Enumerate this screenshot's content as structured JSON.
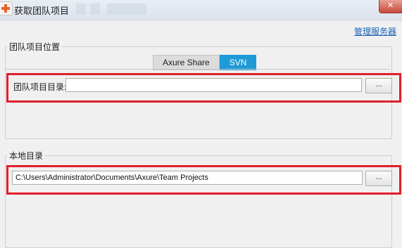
{
  "window": {
    "title": "获取团队项目"
  },
  "header": {
    "manage_link": "管理服务器"
  },
  "team_section": {
    "title": "团队项目位置",
    "tabs": [
      {
        "label": "Axure Share",
        "active": false
      },
      {
        "label": "SVN",
        "active": true
      }
    ],
    "dir_label": "团队项目目录:",
    "dir_value": "",
    "browse_label": "..."
  },
  "local_section": {
    "title": "本地目录",
    "path_value": "C:\\Users\\Administrator\\Documents\\Axure\\Team Projects",
    "browse_label": "..."
  },
  "colors": {
    "accent": "#1e9ad6",
    "highlight": "#e01e2b",
    "link": "#1a62b5"
  }
}
